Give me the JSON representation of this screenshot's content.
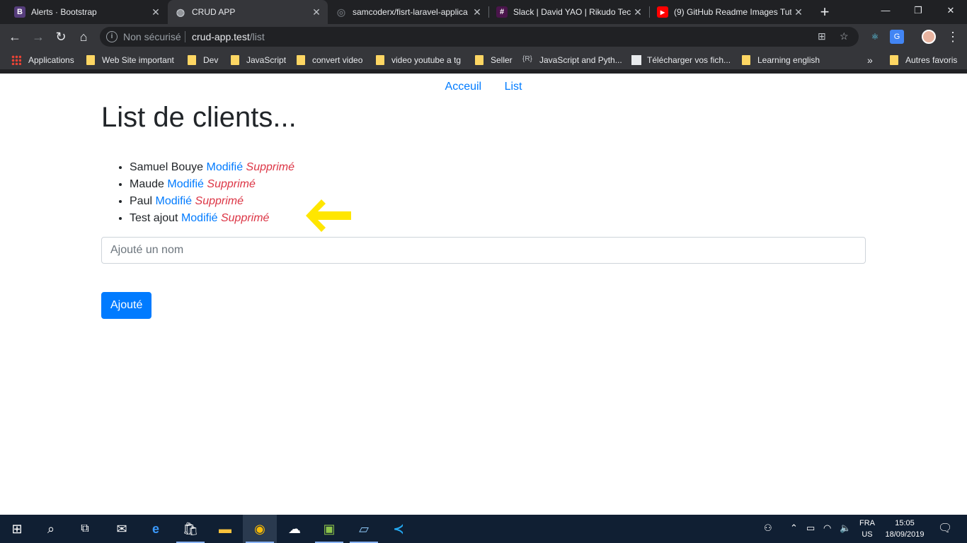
{
  "browser": {
    "tabs": [
      {
        "title": "Alerts · Bootstrap",
        "favicon": "B",
        "favicon_color": "#563d7c",
        "active": false
      },
      {
        "title": "CRUD APP",
        "favicon": "◍",
        "favicon_color": "#5f6368",
        "active": true
      },
      {
        "title": "samcoderx/fisrt-laravel-applica",
        "favicon": "◎",
        "favicon_color": "#202124",
        "active": false
      },
      {
        "title": "Slack | David YAO | Rikudo Tech",
        "favicon": "#",
        "favicon_color": "#4a154b",
        "active": false
      },
      {
        "title": "(9) GitHub Readme Images Tut",
        "favicon": "▶",
        "favicon_color": "#ff0000",
        "active": false
      }
    ],
    "new_tab_label": "+",
    "address_bar": {
      "security_label": "Non sécurisé",
      "url_host": "crud-app.test",
      "url_path": "/list"
    },
    "bookmarks": [
      {
        "label": "Applications",
        "icon": "apps-grid"
      },
      {
        "label": "Web Site important",
        "icon": "folder"
      },
      {
        "label": "Dev",
        "icon": "folder"
      },
      {
        "label": "JavaScript",
        "icon": "folder"
      },
      {
        "label": "convert video",
        "icon": "folder"
      },
      {
        "label": "video youtube a tg",
        "icon": "folder"
      },
      {
        "label": "Seller",
        "icon": "folder"
      },
      {
        "label": "JavaScript and Pyth...",
        "icon": "r-logo"
      },
      {
        "label": "Télécharger vos fich...",
        "icon": "file"
      },
      {
        "label": "Learning english",
        "icon": "folder"
      }
    ],
    "bookmarks_overflow": "»",
    "other_bookmarks": "Autres favoris"
  },
  "page": {
    "nav": {
      "home": "Acceuil",
      "list": "List"
    },
    "title": "List de clients...",
    "clients": [
      {
        "name": "Samuel Bouye",
        "edit": "Modifié",
        "delete": "Supprimé"
      },
      {
        "name": "Maude",
        "edit": "Modifié",
        "delete": "Supprimé"
      },
      {
        "name": "Paul",
        "edit": "Modifié",
        "delete": "Supprimé"
      },
      {
        "name": "Test ajout",
        "edit": "Modifié",
        "delete": "Supprimé"
      }
    ],
    "form": {
      "name_placeholder": "Ajouté un nom",
      "submit_label": "Ajouté"
    },
    "annotation_arrow_color": "#ffe600"
  },
  "taskbar": {
    "language": {
      "top": "FRA",
      "bottom": "US"
    },
    "time": "15:05",
    "date": "18/09/2019"
  }
}
